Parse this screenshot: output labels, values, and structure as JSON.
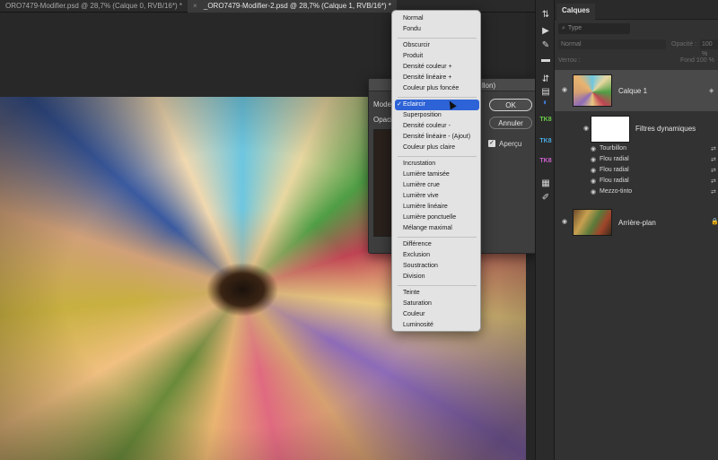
{
  "tabs": [
    {
      "title": "ORO7479-Modifier.psd @ 28,7% (Calque 0, RVB/16*) *",
      "close": "×"
    },
    {
      "title": "_ORO7479-Modifier-2.psd @ 28,7% (Calque 1, RVB/16*) *",
      "close": "×"
    }
  ],
  "layers_panel": {
    "title": "Calques",
    "filter_placeholder": "Type",
    "blend_mode": "Normal",
    "opacity_label": "Opacité :",
    "opacity_value": "100 %",
    "lock_label": "Verrou :",
    "fill_label": "Fond :",
    "fill_value": "100 %",
    "layers": [
      {
        "name": "Calque 1"
      },
      {
        "name": "Filtres dynamiques"
      },
      {
        "name": "Arrière-plan"
      }
    ],
    "filters": [
      "Tourbillon",
      "Flou radial",
      "Flou radial",
      "Flou radial",
      "Mezzo-tinto"
    ]
  },
  "tools": [
    {
      "icon": "pan-icon",
      "glyph": "⇅"
    },
    {
      "icon": "play-icon",
      "glyph": "▶"
    },
    {
      "icon": "note-icon",
      "glyph": "✎"
    },
    {
      "icon": "comment-icon",
      "glyph": "▬"
    },
    {
      "icon": "adjust-icon",
      "glyph": "⇵"
    },
    {
      "icon": "swatch-icon",
      "glyph": "▤"
    },
    {
      "icon": "channels-icon",
      "glyph": "◐"
    },
    {
      "icon": "tk8-mm-icon",
      "glyph": "TK8"
    },
    {
      "icon": "tk8-cx-icon",
      "glyph": "TK8"
    },
    {
      "icon": "tk8-co-icon",
      "glyph": "TK8"
    },
    {
      "icon": "panel-icon",
      "glyph": "▦"
    },
    {
      "icon": "brush-icon",
      "glyph": "✐"
    }
  ],
  "dialog": {
    "title_fragment": "llon)",
    "mode_label": "Mode",
    "opacity_label": "Opaci",
    "ok": "OK",
    "cancel": "Annuler",
    "preview_label": "Aperçu",
    "preview_checked": true
  },
  "blend_menu": {
    "selected": "Eclaircir",
    "groups": [
      [
        "Normal",
        "Fondu"
      ],
      [
        "Obscurcir",
        "Produit",
        "Densité couleur +",
        "Densité linéaire +",
        "Couleur plus foncée"
      ],
      [
        "Eclaircir",
        "Superposition",
        "Densité couleur -",
        "Densité linéaire - (Ajout)",
        "Couleur plus claire"
      ],
      [
        "Incrustation",
        "Lumière tamisée",
        "Lumière crue",
        "Lumière vive",
        "Lumière linéaire",
        "Lumière ponctuelle",
        "Mélange maximal"
      ],
      [
        "Différence",
        "Exclusion",
        "Soustraction",
        "Division"
      ],
      [
        "Teinte",
        "Saturation",
        "Couleur",
        "Luminosité"
      ]
    ]
  },
  "colors": {
    "menu_highlight": "#2d63d6",
    "panel_bg": "#323232",
    "app_bg": "#1e1e1e"
  }
}
